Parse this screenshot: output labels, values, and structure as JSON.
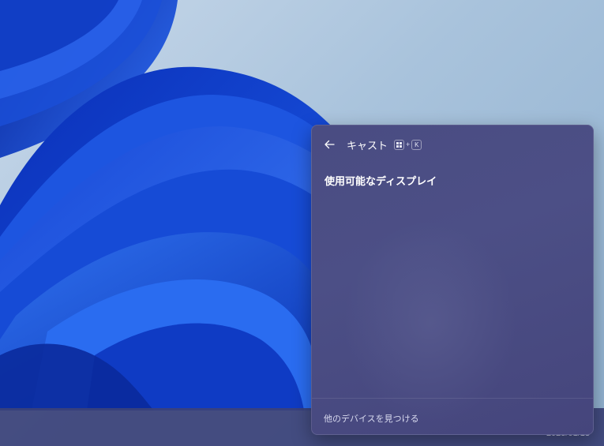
{
  "cast_panel": {
    "title": "キャスト",
    "shortcut": {
      "key": "K",
      "plus": "+"
    },
    "section_heading": "使用可能なディスプレイ",
    "footer_link": "他のデバイスを見つける"
  },
  "taskbar": {
    "clock_partial": "2023/01/13"
  },
  "colors": {
    "panel_bg": "#4a4c82",
    "wallpaper_blue": "#1f4fd6",
    "taskbar_bg": "#3c4278"
  },
  "icons": {
    "back": "back-arrow-icon",
    "windows_key": "windows-logo-icon"
  }
}
